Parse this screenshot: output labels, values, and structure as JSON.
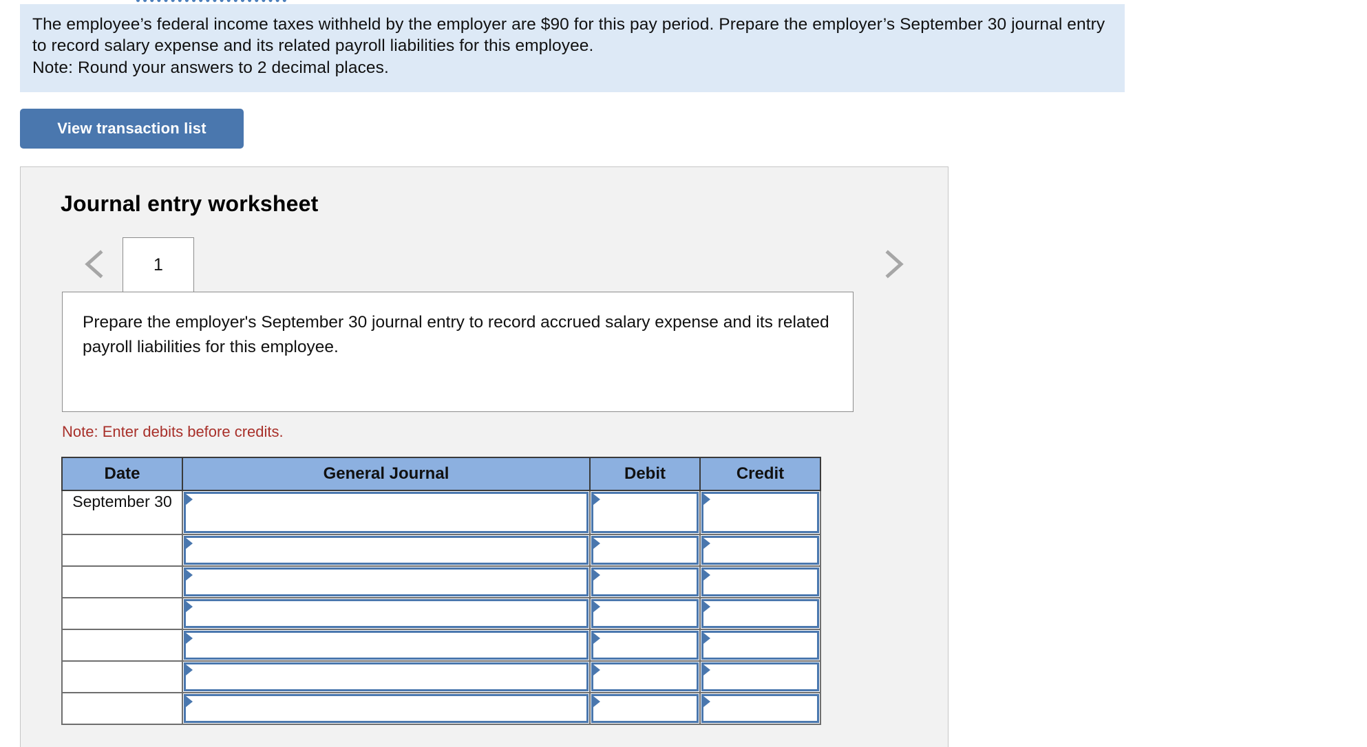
{
  "banner": {
    "paragraph": "The employee’s federal income taxes withheld by the employer are $90 for this pay period. Prepare the employer’s September 30 journal entry to record salary expense and its related payroll liabilities for this employee.",
    "note": "Note: Round your answers to 2 decimal places.",
    "background_color": "#dde9f6",
    "note_color": "#a8302a"
  },
  "toolbar": {
    "view_transaction_list_label": "View transaction list",
    "button_color": "#4a77ae"
  },
  "worksheet": {
    "title": "Journal entry worksheet",
    "tabs": [
      {
        "label": "1",
        "active": true
      }
    ],
    "prev_arrow_icon": "chevron-left-icon",
    "next_arrow_icon": "chevron-right-icon",
    "instruction": "Prepare the employer's September 30 journal entry to record accrued salary expense and its related payroll liabilities for this employee.",
    "debit_note": "Note: Enter debits before credits.",
    "card_background": "#f2f2f2"
  },
  "journal_table": {
    "header_color": "#8cb0e0",
    "input_border_color": "#4a77ae",
    "columns": [
      "Date",
      "General Journal",
      "Debit",
      "Credit"
    ],
    "rows": [
      {
        "date": "September 30",
        "general_journal": "",
        "debit": "",
        "credit": "",
        "tall": true
      },
      {
        "date": "",
        "general_journal": "",
        "debit": "",
        "credit": "",
        "tall": false
      },
      {
        "date": "",
        "general_journal": "",
        "debit": "",
        "credit": "",
        "tall": false
      },
      {
        "date": "",
        "general_journal": "",
        "debit": "",
        "credit": "",
        "tall": false
      },
      {
        "date": "",
        "general_journal": "",
        "debit": "",
        "credit": "",
        "tall": false
      },
      {
        "date": "",
        "general_journal": "",
        "debit": "",
        "credit": "",
        "tall": false
      },
      {
        "date": "",
        "general_journal": "",
        "debit": "",
        "credit": "",
        "tall": false
      }
    ]
  }
}
